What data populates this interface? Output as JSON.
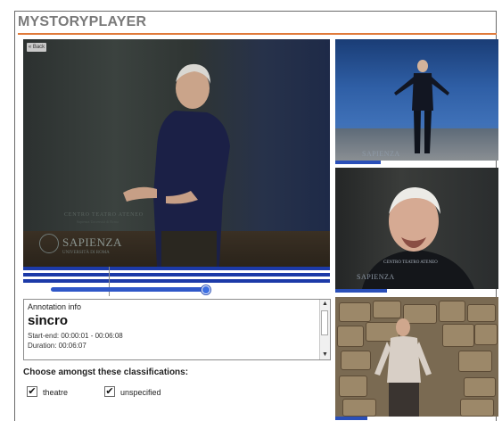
{
  "app": {
    "title": "MYSTORYPLAYER"
  },
  "main_video": {
    "back_button_label": "« Back",
    "watermark_top": "CENTRO TEATRO ATENEO",
    "watermark_top_sub": "Sapienza Università di Roma",
    "watermark": "SAPIENZA",
    "watermark_sub": "UNIVERSITÀ DI ROMA"
  },
  "thumbnails": [
    {
      "watermark": "SAPIENZA",
      "progress": 0.27
    },
    {
      "watermark": "SAPIENZA",
      "watermark_top": "CENTRO TEATRO ATENEO",
      "progress": 0.32
    },
    {
      "watermark": "",
      "progress": 0.2
    }
  ],
  "annotation": {
    "heading": "Annotation info",
    "title": "sincro",
    "start_end": "Start-end: 00:00:01 - 00:06:08",
    "duration": "Duration: 00:06:07"
  },
  "classifications": {
    "label": "Choose amongst these classifications:",
    "options": [
      {
        "label": "theatre",
        "checked": true
      },
      {
        "label": "unspecified",
        "checked": true
      }
    ]
  },
  "colors": {
    "accent": "#e07a3a",
    "timeline": "#1c3aa8",
    "title": "#7a7a7a"
  }
}
